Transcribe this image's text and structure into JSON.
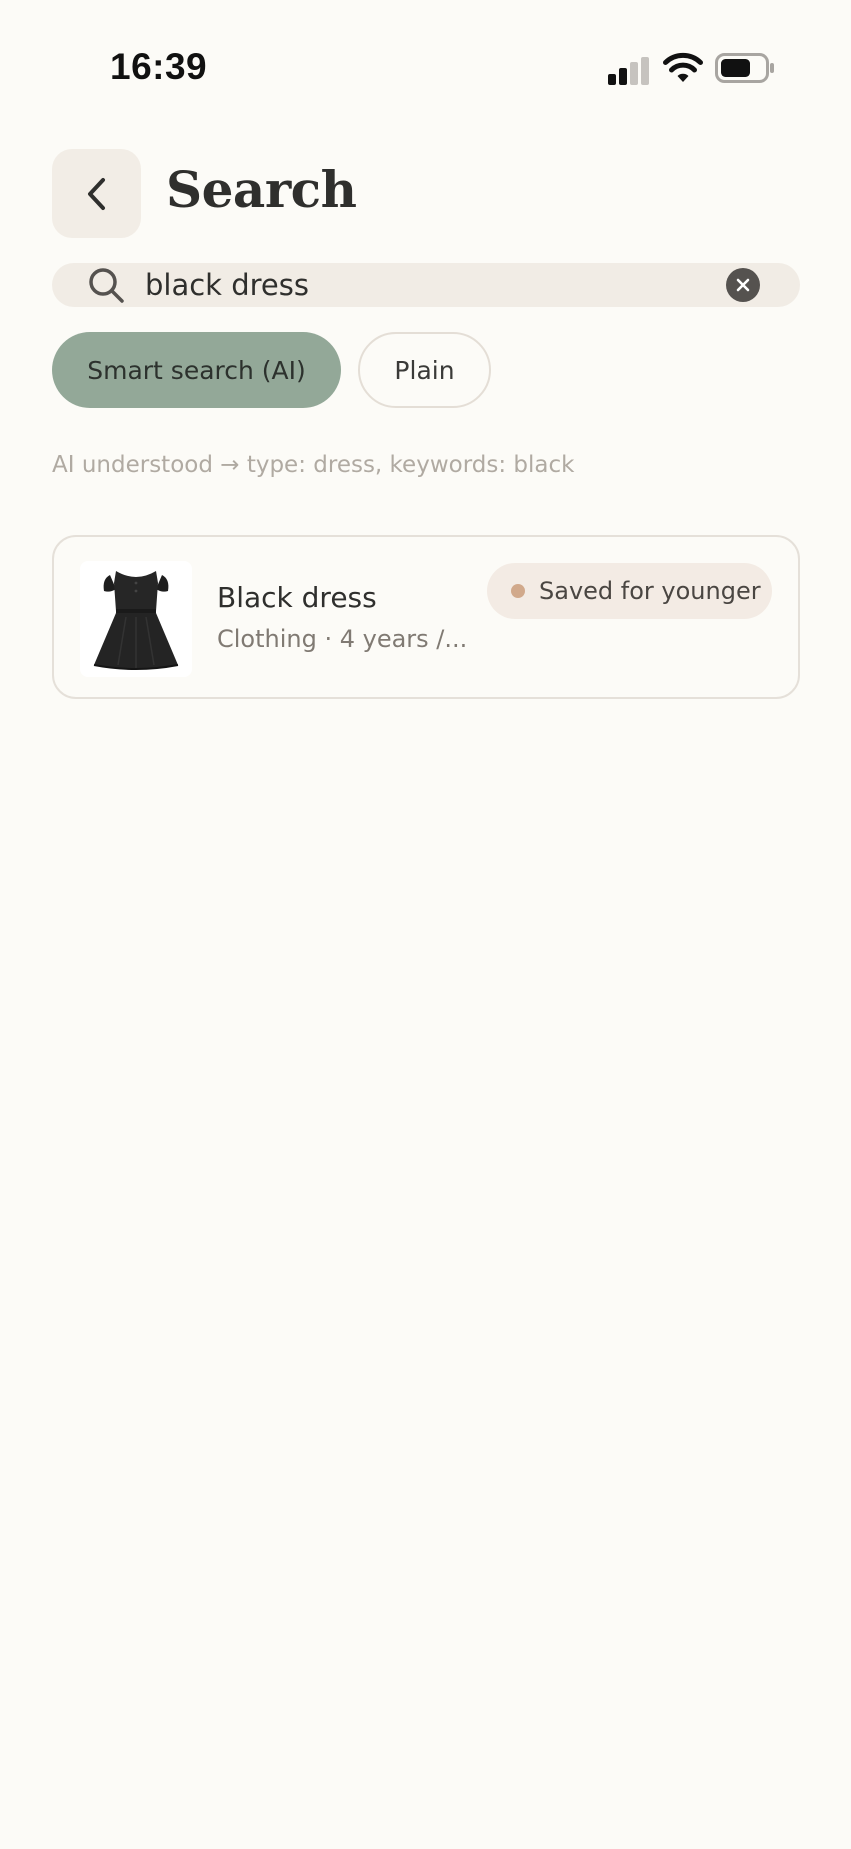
{
  "status_bar": {
    "time": "16:39"
  },
  "header": {
    "title": "Search",
    "back_icon": "chevron-left-icon"
  },
  "search": {
    "value": "black dress",
    "icon": "search-icon",
    "clear_icon": "clear-icon"
  },
  "modes": {
    "ai_label": "Smart search (AI)",
    "plain_label": "Plain",
    "selected": "ai"
  },
  "ai_hint": "AI understood → type: dress, keywords: black",
  "results": [
    {
      "title": "Black dress",
      "subtitle": "Clothing · 4 years /...",
      "badge": "Saved for younger",
      "thumbnail": "black-dress-image"
    }
  ],
  "colors": {
    "background": "#fcfbf7",
    "accent_sage": "#93a898",
    "badge_bg": "#f3ebe4",
    "badge_dot": "#d1a98b"
  }
}
